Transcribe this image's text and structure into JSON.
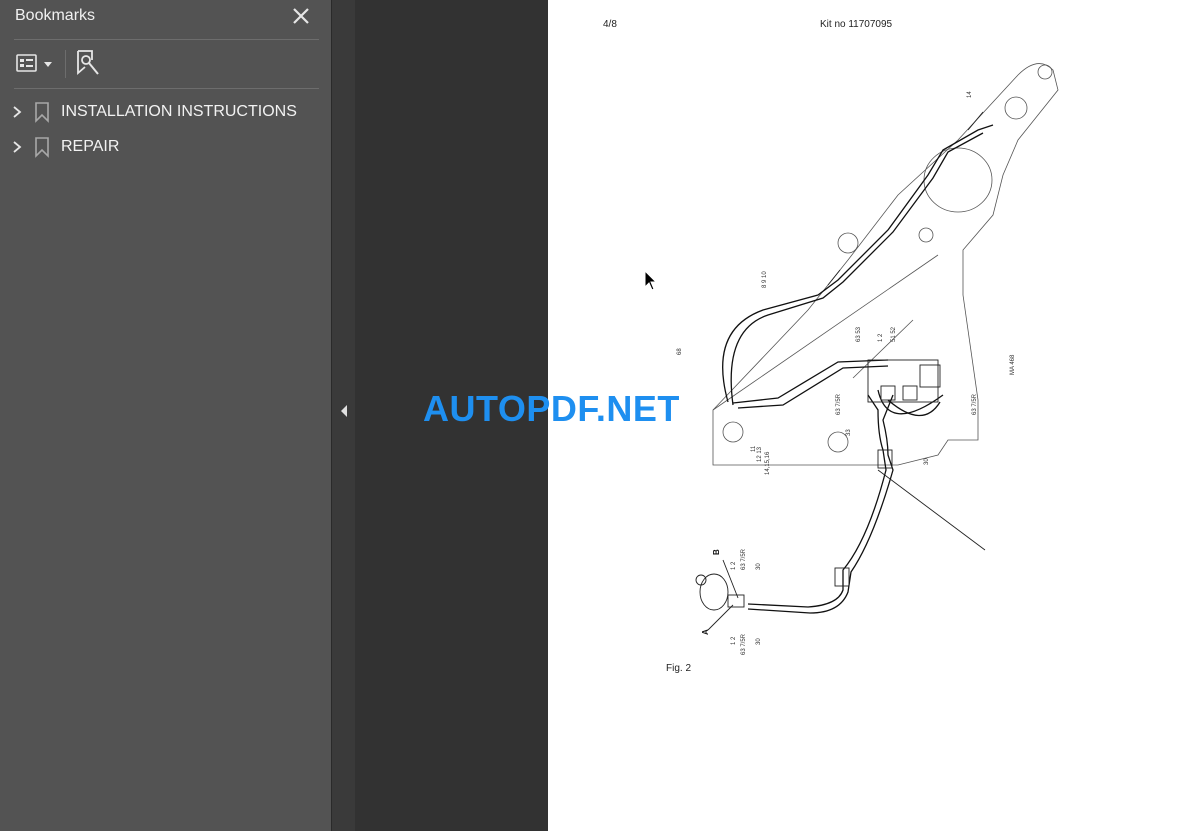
{
  "sidebar": {
    "title": "Bookmarks",
    "close_icon": "close-icon",
    "toolbar": {
      "options_icon": "bookmark-options-icon",
      "find_icon": "find-bookmark-icon"
    },
    "items": [
      {
        "label": "INSTALLATION INSTRUCTIONS",
        "icon": "bookmark-icon",
        "expander": "chevron-right-icon"
      },
      {
        "label": "REPAIR",
        "icon": "bookmark-icon",
        "expander": "chevron-right-icon"
      }
    ]
  },
  "document": {
    "page_number": "4/8",
    "kit_number": "Kit no 11707095",
    "figure_caption": "Fig. 2",
    "drawing_ref": "MA 468",
    "callouts": [
      "14",
      "8",
      "9",
      "10",
      "68",
      "63",
      "53",
      "33",
      "11",
      "12",
      "13",
      "14,15,16",
      "51",
      "52",
      "1",
      "2",
      "63,7",
      "63 7/5R",
      "30",
      "A",
      "B",
      "C"
    ]
  },
  "watermark": {
    "text": "AUTOPDF.NET",
    "color": "#1e8ff0"
  },
  "colors": {
    "sidebar_bg": "#535353",
    "doc_bg": "#323232",
    "page_bg": "#ffffff"
  }
}
